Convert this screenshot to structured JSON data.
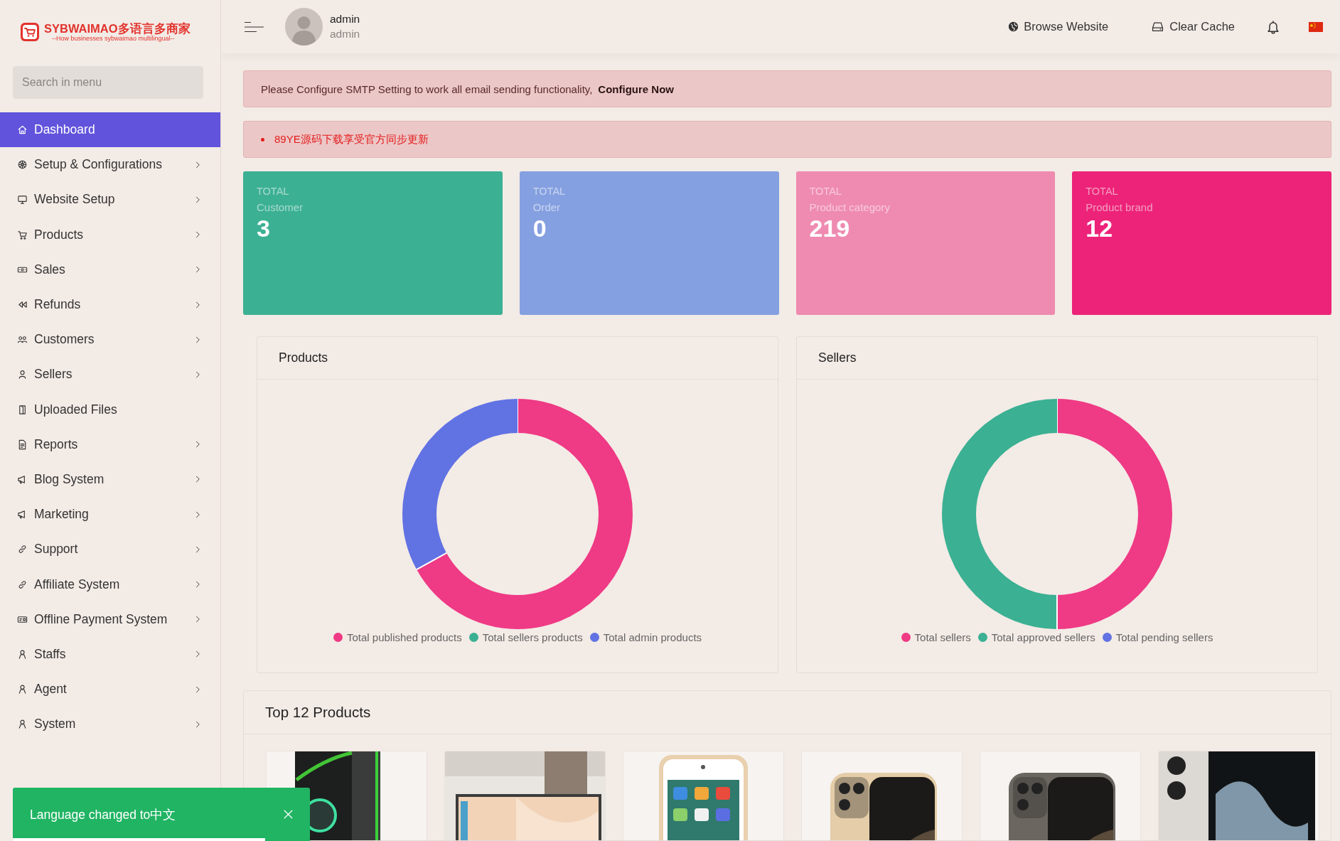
{
  "brand": {
    "name": "SYBWAIMAO多语言多商家",
    "tagline": "--How businesses sybwaimao multilingual--"
  },
  "sidebar": {
    "search": {
      "placeholder": "Search in menu"
    },
    "items": [
      {
        "label": "Dashboard",
        "selected": true,
        "expandable": false
      },
      {
        "label": "Setup & Configurations",
        "selected": false,
        "expandable": true
      },
      {
        "label": "Website Setup",
        "selected": false,
        "expandable": true
      },
      {
        "label": "Products",
        "selected": false,
        "expandable": true
      },
      {
        "label": "Sales",
        "selected": false,
        "expandable": true
      },
      {
        "label": "Refunds",
        "selected": false,
        "expandable": true
      },
      {
        "label": "Customers",
        "selected": false,
        "expandable": true
      },
      {
        "label": "Sellers",
        "selected": false,
        "expandable": true
      },
      {
        "label": "Uploaded Files",
        "selected": false,
        "expandable": false
      },
      {
        "label": "Reports",
        "selected": false,
        "expandable": true
      },
      {
        "label": "Blog System",
        "selected": false,
        "expandable": true
      },
      {
        "label": "Marketing",
        "selected": false,
        "expandable": true
      },
      {
        "label": "Support",
        "selected": false,
        "expandable": true
      },
      {
        "label": "Affiliate System",
        "selected": false,
        "expandable": true
      },
      {
        "label": "Offline Payment System",
        "selected": false,
        "expandable": true
      },
      {
        "label": "Staffs",
        "selected": false,
        "expandable": true
      },
      {
        "label": "Agent",
        "selected": false,
        "expandable": true
      },
      {
        "label": "System",
        "selected": false,
        "expandable": true
      }
    ]
  },
  "header": {
    "user": {
      "name": "admin",
      "role": "admin"
    },
    "actions": [
      {
        "label": "Browse Website"
      },
      {
        "label": "Clear Cache"
      }
    ]
  },
  "alerts": [
    {
      "kind": "notice",
      "text": "Please Configure SMTP Setting to work all email sending functionality,",
      "link": "Configure Now"
    },
    {
      "kind": "bullet",
      "text": "89YE源码下载享受官方同步更新"
    }
  ],
  "stats": [
    {
      "caption": "TOTAL",
      "label": "Customer",
      "value": "3",
      "color": "#3cb093"
    },
    {
      "caption": "TOTAL",
      "label": "Order",
      "value": "0",
      "color": "#85a0e0"
    },
    {
      "caption": "TOTAL",
      "label": "Product category",
      "value": "219",
      "color": "#ef8bb0"
    },
    {
      "caption": "TOTAL",
      "label": "Product brand",
      "value": "12",
      "color": "#ec2378"
    }
  ],
  "charts": [
    {
      "title": "Products",
      "legend": [
        {
          "label": "Total published products",
          "color": "#ef3a85"
        },
        {
          "label": "Total sellers products",
          "color": "#3bb093"
        },
        {
          "label": "Total admin products",
          "color": "#6172e3"
        }
      ]
    },
    {
      "title": "Sellers",
      "legend": [
        {
          "label": "Total sellers",
          "color": "#ef3a85"
        },
        {
          "label": "Total approved sellers",
          "color": "#3bb093"
        },
        {
          "label": "Total pending sellers",
          "color": "#6172e3"
        }
      ]
    }
  ],
  "top_products": {
    "title": "Top 12 Products"
  },
  "toast": {
    "text": "Language changed to中文",
    "level": 0.85
  }
}
